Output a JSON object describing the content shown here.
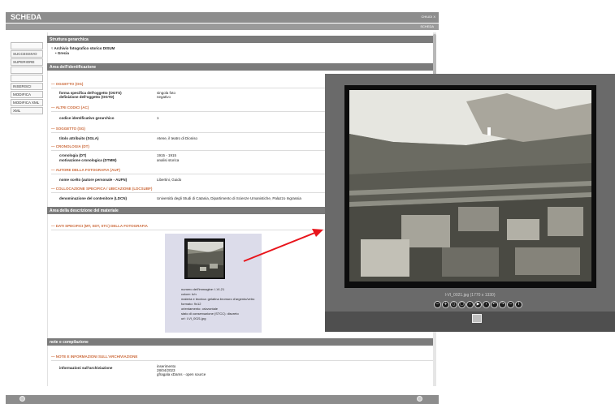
{
  "topbar": {
    "title": "SCHEDA",
    "close": "CHIUDI X",
    "scheda_link": "SCHEDA"
  },
  "nav": {
    "items": [
      {
        "label": ""
      },
      {
        "label": "SUCCESSIVO"
      },
      {
        "label": "SUPERIORE"
      },
      {
        "label": ""
      },
      {
        "label": ""
      },
      {
        "label": "INSERISCI"
      },
      {
        "label": "MODIFICA"
      },
      {
        "label": "MODIFICA XML"
      },
      {
        "label": "XML"
      }
    ]
  },
  "struttura": {
    "header": "Struttura gerarchica",
    "tree_root": "Archivio fotografico storico DISUM",
    "tree_child": "Grecia"
  },
  "identificazione": {
    "header": "Area dell'identificazione",
    "oggetto": {
      "title": "OGGETTO (OG)",
      "rows": [
        {
          "label": "forma specifica dell'oggetto (OGTS)",
          "value": "singola foto"
        },
        {
          "label": "definizione dell'oggetto (OGTD)",
          "value": "negativo"
        }
      ]
    },
    "altri_codici": {
      "title": "ALTRI CODICI (AC)",
      "rows": [
        {
          "label": "codice identificativo gerarchico",
          "value": "1"
        }
      ]
    },
    "soggetto": {
      "title": "SOGGETTO (SG)",
      "rows": [
        {
          "label": "titolo attribuito (SGLA)",
          "value": "Atene, il teatro di Dioniso"
        }
      ]
    },
    "cronologia": {
      "title": "CRONOLOGIA (DT)",
      "rows": [
        {
          "label": "cronologia (DT)",
          "value": "1915 - 1915"
        },
        {
          "label": "motivazione cronologica (DTMM)",
          "value": "analisi storica"
        }
      ]
    },
    "autore": {
      "title": "AUTORE DELLA FOTOGRAFIA (AUF)",
      "rows": [
        {
          "label": "nome scelto (autore personale - AUFN)",
          "value": "Libertini, Guido"
        }
      ]
    },
    "collocazione": {
      "title": "COLLOCAZIONE SPECIFICA / UBICAZIONE (LDCSUBF)",
      "rows": [
        {
          "label": "denominazione del contenitore (LDCN)",
          "value": "Università degli Studi di Catania, Dipartimento di Scienze Umanistiche, Palazzo Ingrassia"
        }
      ]
    }
  },
  "descrizione": {
    "header": "Area della descrizione del materiale",
    "dati_title": "DATI SPECIFICI (MT, SDT, STC) DELLA FOTOGRAFIA",
    "info": [
      "numero dell'immagine: I-VI-21",
      "colore: b/n",
      "materia e tecnica: gelatina bromuro d'argento/vetro",
      "formato: 9x12",
      "orientamento: orizzontale",
      "stato di conservazione (STCC): discreto",
      "url: I-VI_0021.jpg"
    ]
  },
  "note": {
    "header": "note e compilazione",
    "title": "NOTE E INFORMAZIONI SULL'ARCHIVIAZIONE",
    "label": "informazioni sull'archiviazione",
    "values": [
      "inserimento",
      "28/04/2023",
      "gfragala xDams - open source"
    ]
  },
  "viewer": {
    "caption": "I-VI_0021.jpg (1770 x 1330)",
    "controls": [
      {
        "icon": "zoom-out-icon",
        "glyph": "−"
      },
      {
        "icon": "zoom-in-icon",
        "glyph": "+"
      },
      {
        "icon": "actual-size-icon",
        "glyph": "▯"
      },
      {
        "icon": "fit-icon",
        "glyph": "▢"
      },
      {
        "icon": "prev-icon",
        "glyph": "‹"
      },
      {
        "icon": "play-icon",
        "glyph": "▶"
      },
      {
        "icon": "next-icon",
        "glyph": "›"
      },
      {
        "icon": "rotate-left-icon",
        "glyph": "↶"
      },
      {
        "icon": "rotate-right-icon",
        "glyph": "↷"
      },
      {
        "icon": "reset-icon",
        "glyph": "−"
      },
      {
        "icon": "info-icon",
        "glyph": "i"
      }
    ]
  },
  "colors": {
    "accent": "#cc6a3b",
    "header": "#7b7b7b",
    "topbar": "#8d8d8d",
    "arrow": "#e8141b"
  }
}
